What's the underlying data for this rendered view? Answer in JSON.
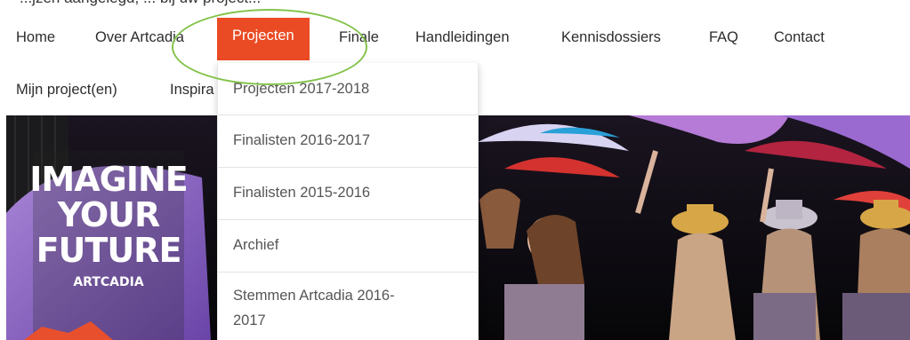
{
  "top_text": "...jzen aangelegd, ... bij uw project...",
  "nav": {
    "row1": [
      {
        "label": "Home"
      },
      {
        "label": "Over Artcadia"
      },
      {
        "label": "Projecten"
      },
      {
        "label": "Finale"
      },
      {
        "label": "Handleidingen"
      },
      {
        "label": "Kennisdossiers"
      },
      {
        "label": "FAQ"
      },
      {
        "label": "Contact"
      }
    ],
    "row2": [
      {
        "label": "Mijn project(en)"
      },
      {
        "label": "Inspira"
      }
    ],
    "active": "Projecten"
  },
  "dropdown": {
    "items": [
      {
        "label": "Projecten 2017-2018"
      },
      {
        "label": "Finalisten 2016-2017"
      },
      {
        "label": "Finalisten 2015-2016"
      },
      {
        "label": "Archief"
      },
      {
        "label_line1": "Stemmen Artcadia 2016-",
        "label_line2": "2017"
      }
    ]
  },
  "hero": {
    "poster_lines": [
      "IMAGINE",
      "YOUR",
      "FUTURE"
    ],
    "poster_brand": "ARTCADIA"
  },
  "colors": {
    "accent": "#ea4b24",
    "highlight": "#83c24a"
  }
}
